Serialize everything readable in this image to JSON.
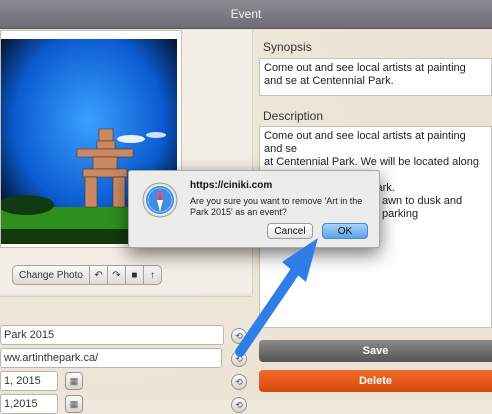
{
  "window": {
    "title": "Event"
  },
  "photo_panel": {
    "change_photo_label": "Change Photo",
    "tools": [
      "rotate-left-icon",
      "rotate-right-icon",
      "trash-icon",
      "share-icon"
    ]
  },
  "form": {
    "name_value": "Park 2015",
    "url_value": "ww.artinthepark.ca/",
    "date_value": "1, 2015",
    "time_value": "1,2015"
  },
  "synopsis": {
    "label": "Synopsis",
    "text": "Come out and see local artists at painting and se at Centennial Park."
  },
  "description": {
    "label": "Description",
    "text_line1": "Come out and see local artists at painting and se",
    "text_line2": "at Centennial Park. We will be located along the v",
    "text_line3": "at the east end of the park.",
    "text_line4": "awn to dusk and parking"
  },
  "actions": {
    "save_label": "Save",
    "delete_label": "Delete"
  },
  "dialog": {
    "title": "https://ciniki.com",
    "message": "Are you sure you want to remove 'Art in the Park 2015' as an event?",
    "cancel_label": "Cancel",
    "ok_label": "OK",
    "icon": "safari-compass-icon"
  },
  "colors": {
    "delete": "#e0561a",
    "save": "#6b6b6b",
    "arrow": "#2f7ee8",
    "ok_button": "#5aa3ec"
  }
}
